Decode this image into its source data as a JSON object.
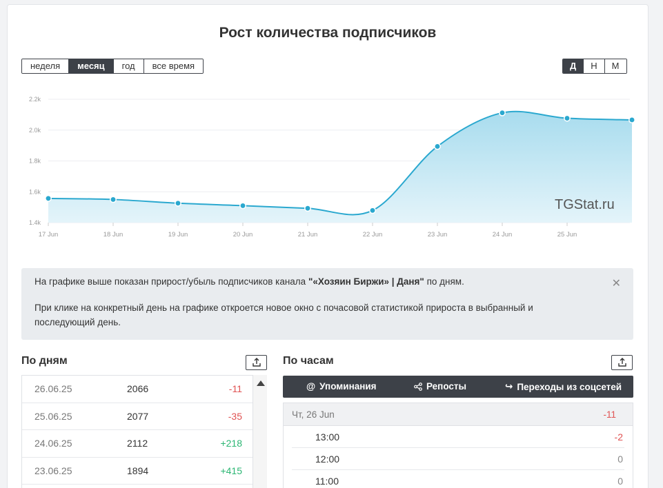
{
  "page": {
    "title": "Рост количества подписчиков",
    "watermark": "TGStat.ru"
  },
  "range_buttons": [
    "неделя",
    "месяц",
    "год",
    "все время"
  ],
  "range_active": "месяц",
  "granularity_buttons": [
    "Д",
    "Н",
    "М"
  ],
  "granularity_active": "Д",
  "chart_data": {
    "type": "area",
    "title": "",
    "x": [
      "17 Jun",
      "18 Jun",
      "19 Jun",
      "20 Jun",
      "21 Jun",
      "22 Jun",
      "23 Jun",
      "24 Jun",
      "25 Jun",
      "26 Jun"
    ],
    "x_tick_labels": [
      "17 Jun",
      "18 Jun",
      "19 Jun",
      "20 Jun",
      "21 Jun",
      "22 Jun",
      "23 Jun",
      "24 Jun",
      "25 Jun"
    ],
    "series": [
      {
        "values": [
          1557,
          1550,
          1526,
          1510,
          1493,
          1479,
          1894,
          2112,
          2077,
          2066
        ]
      }
    ],
    "yticks": [
      1400,
      1600,
      1800,
      2000,
      2200
    ],
    "ytick_labels": [
      "1.4k",
      "1.6k",
      "1.8k",
      "2.0k",
      "2.2k"
    ],
    "ylim": [
      1400,
      2200
    ],
    "grid": true,
    "colors": {
      "line": "#2aa8cf",
      "fill_top": "#a8dcee",
      "fill_bottom": "#e4f4fa"
    }
  },
  "info": {
    "line1_prefix": "На графике выше показан прирост/убыль подписчиков канала ",
    "channel": "\"«Хозяин Биржи» | Даня\"",
    "line1_suffix": " по дням.",
    "line2": "При клике на конкретный день на графике откроется новое окно с почасовой статистикой прироста в выбранный и последующий день.",
    "close": "✕"
  },
  "by_days": {
    "title": "По дням",
    "rows": [
      {
        "date": "26.06.25",
        "value": "2066",
        "change": "-11"
      },
      {
        "date": "25.06.25",
        "value": "2077",
        "change": "-35"
      },
      {
        "date": "24.06.25",
        "value": "2112",
        "change": "+218"
      },
      {
        "date": "23.06.25",
        "value": "1894",
        "change": "+415"
      }
    ]
  },
  "by_hours": {
    "title": "По часам",
    "tabs": [
      {
        "icon": "at-icon",
        "label": "Упоминания"
      },
      {
        "icon": "share-icon",
        "label": "Репосты"
      },
      {
        "icon": "redirect-icon",
        "label": "Переходы из соцсетей"
      }
    ],
    "head": {
      "day": "Чт, 26 Jun",
      "change": "-11"
    },
    "rows": [
      {
        "time": "13:00",
        "change": "-2"
      },
      {
        "time": "12:00",
        "change": "0"
      },
      {
        "time": "11:00",
        "change": "0"
      }
    ]
  },
  "colors": {
    "dark": "#3d4148",
    "negative": "#e05252",
    "positive": "#2bb673"
  }
}
